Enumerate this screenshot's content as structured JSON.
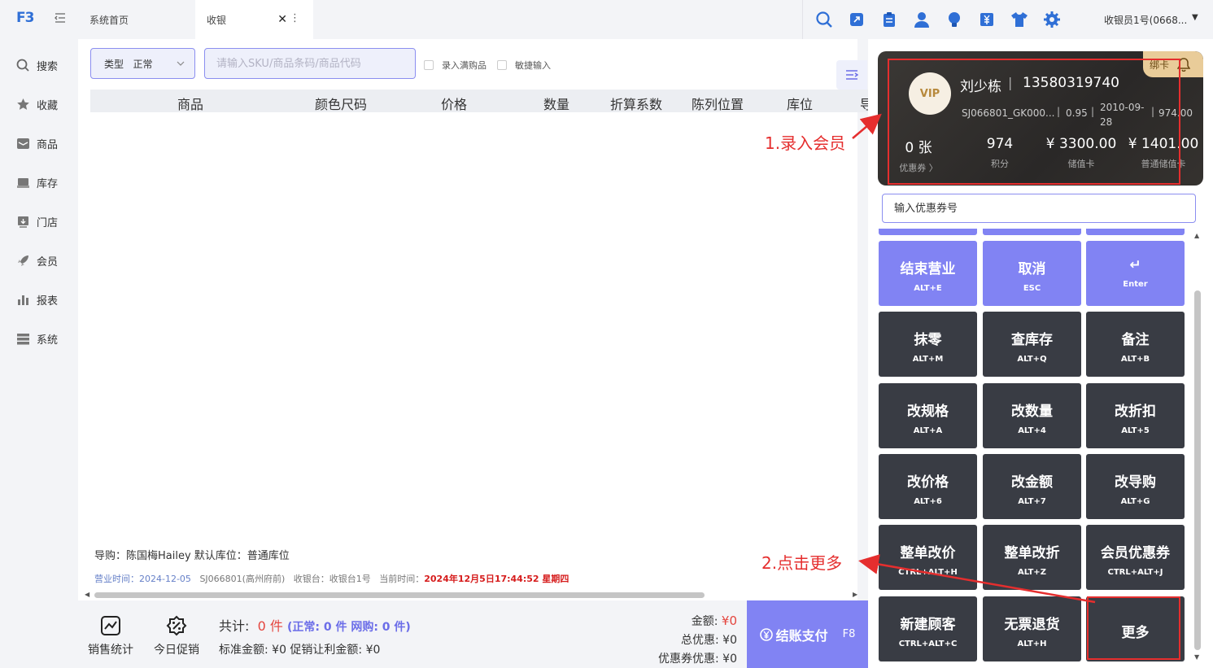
{
  "app": {
    "logo": "F3"
  },
  "sidebar": {
    "items": [
      {
        "label": "搜索",
        "icon": "search-icon"
      },
      {
        "label": "收藏",
        "icon": "star-icon"
      },
      {
        "label": "商品",
        "icon": "mail-icon"
      },
      {
        "label": "库存",
        "icon": "inventory-icon"
      },
      {
        "label": "门店",
        "icon": "store-icon"
      },
      {
        "label": "会员",
        "icon": "rocket-icon"
      },
      {
        "label": "报表",
        "icon": "bar-chart-icon"
      },
      {
        "label": "系统",
        "icon": "server-icon"
      }
    ]
  },
  "tabs": {
    "home": "系统首页",
    "active": "收银",
    "close": "✕",
    "more": "⋮"
  },
  "topbar": {
    "user": "收银员1号(0668...",
    "caret": "▼"
  },
  "toolbar": {
    "type_label": "类型",
    "type_value": "正常",
    "sku_placeholder": "请输入SKU/商品条码/商品代码",
    "chk_full": "录入满购品",
    "chk_quick": "敏捷输入"
  },
  "grid": {
    "columns": [
      "商品",
      "颜色尺码",
      "价格",
      "数量",
      "折算系数",
      "陈列位置",
      "库位",
      "导"
    ]
  },
  "info": {
    "guide": "导购：陈国梅Hailey  默认库位：普通库位",
    "biz_time_label": "营业时间：",
    "biz_time": "2024-12-05",
    "store": "SJ066801(高州府前)",
    "register_label": "收银台：",
    "register": "收银台1号",
    "now_label": "当前时间：",
    "now": "2024年12月5日17:44:52 星期四"
  },
  "bottom": {
    "tool_sales": "销售统计",
    "tool_promo": "今日促销",
    "total_label": "共计:",
    "total_value": "0 件",
    "total_detail": "(正常: 0 件  网购: 0 件)",
    "std_amount": "标准金额: ¥0  促销让利金额: ¥0",
    "amount_label": "金额:",
    "amount_value": "¥0",
    "discount_label": "总优惠:",
    "discount_value": "¥0",
    "coupon_label": "优惠券优惠:",
    "coupon_value": "¥0",
    "pay_label": "结账支付",
    "pay_key": "F8"
  },
  "member": {
    "vip": "VIP",
    "name": "刘少栋",
    "sep": "|",
    "phone": "13580319740",
    "code": "SJ066801_GK000...",
    "discount": "0.95",
    "date": "2010-09-28",
    "points_top": "974.00",
    "bind_card": "绑卡",
    "coupons": "0 张",
    "coupons_label": "优惠券 〉",
    "points": "974",
    "points_label": "积分",
    "stored": "¥ 3300.00",
    "stored_label": "储值卡",
    "normal_stored": "¥ 1401.00",
    "normal_stored_label": "普通储值卡"
  },
  "coupon_input": {
    "placeholder": "输入优惠券号"
  },
  "keys": [
    {
      "title": "结束营业",
      "sub": "ALT+E",
      "purple": true
    },
    {
      "title": "取消",
      "sub": "ESC",
      "purple": true
    },
    {
      "title": "↵",
      "sub": "Enter",
      "purple": true
    },
    {
      "title": "抹零",
      "sub": "ALT+M"
    },
    {
      "title": "查库存",
      "sub": "ALT+Q"
    },
    {
      "title": "备注",
      "sub": "ALT+B"
    },
    {
      "title": "改规格",
      "sub": "ALT+A"
    },
    {
      "title": "改数量",
      "sub": "ALT+4"
    },
    {
      "title": "改折扣",
      "sub": "ALT+5"
    },
    {
      "title": "改价格",
      "sub": "ALT+6"
    },
    {
      "title": "改金额",
      "sub": "ALT+7"
    },
    {
      "title": "改导购",
      "sub": "ALT+G"
    },
    {
      "title": "整单改价",
      "sub": "CTRL+ALT+H"
    },
    {
      "title": "整单改折",
      "sub": "ALT+Z"
    },
    {
      "title": "会员优惠券",
      "sub": "CTRL+ALT+J"
    },
    {
      "title": "新建顾客",
      "sub": "CTRL+ALT+C"
    },
    {
      "title": "无票退货",
      "sub": "ALT+H"
    },
    {
      "title": "更多",
      "sub": ""
    }
  ],
  "annotations": {
    "a1": "1.录入会员",
    "a2": "2.点击更多"
  },
  "colors": {
    "accent": "#8183f3",
    "dark_key": "#393c44",
    "annotation": "#e52e2e",
    "brand": "#2f6fd6"
  }
}
